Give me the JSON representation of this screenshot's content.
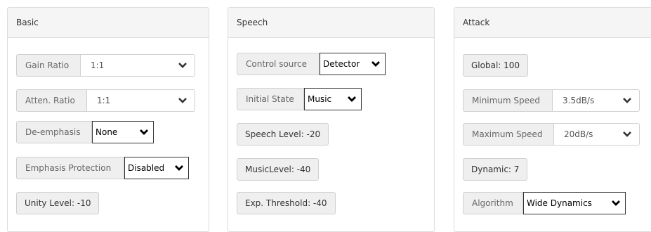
{
  "basic": {
    "title": "Basic",
    "gain_ratio": {
      "label": "Gain Ratio",
      "value": "1:1"
    },
    "atten_ratio": {
      "label": "Atten. Ratio",
      "value": "1:1"
    },
    "de_emphasis": {
      "label": "De-emphasis",
      "value": "None"
    },
    "emphasis_protection": {
      "label": "Emphasis Protection",
      "value": "Disabled"
    },
    "unity_level": "Unity Level: -10"
  },
  "speech": {
    "title": "Speech",
    "control_source": {
      "label": "Control source",
      "value": "Detector"
    },
    "initial_state": {
      "label": "Initial State",
      "value": "Music"
    },
    "speech_level": "Speech Level: -20",
    "music_level": "MusicLevel: -40",
    "exp_threshold": "Exp. Threshold: -40"
  },
  "attack": {
    "title": "Attack",
    "global": "Global: 100",
    "minimum_speed": {
      "label": "Minimum Speed",
      "value": "3.5dB/s"
    },
    "maximum_speed": {
      "label": "Maximum Speed",
      "value": "20dB/s"
    },
    "dynamic": "Dynamic: 7",
    "algorithm": {
      "label": "Algorithm",
      "value": "Wide Dynamics"
    }
  },
  "icons": {
    "dropdown": "chevron-down-icon"
  },
  "colors": {
    "panel_header_bg": "#f5f5f5",
    "label_bg": "#efefef",
    "border": "#dcdcdc"
  }
}
